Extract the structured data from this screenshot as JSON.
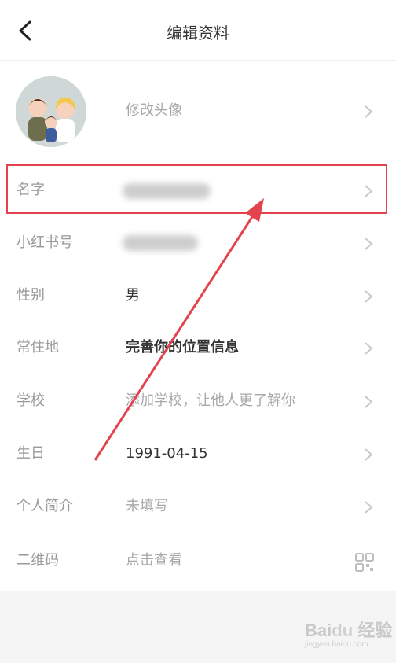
{
  "header": {
    "title": "编辑资料"
  },
  "avatar": {
    "label": "修改头像"
  },
  "fields": {
    "name": {
      "label": "名字",
      "value_obscured": true
    },
    "xhs_id": {
      "label": "小红书号",
      "value_obscured": true
    },
    "gender": {
      "label": "性别",
      "value": "男"
    },
    "location": {
      "label": "常住地",
      "value": "完善你的位置信息"
    },
    "school": {
      "label": "学校",
      "value": "添加学校，让他人更了解你"
    },
    "birthday": {
      "label": "生日",
      "value": "1991-04-15"
    },
    "bio": {
      "label": "个人简介",
      "value": "未填写"
    },
    "qrcode": {
      "label": "二维码",
      "value": "点击查看"
    }
  },
  "colors": {
    "highlight": "#e3434d",
    "label": "#999999",
    "value": "#333333"
  },
  "icons": [
    "back-icon",
    "chevron-right-icon",
    "qr-code-icon"
  ]
}
